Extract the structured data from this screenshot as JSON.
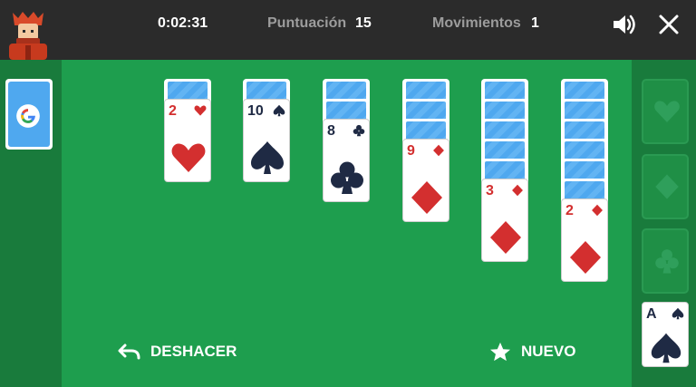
{
  "header": {
    "timer": "0:02:31",
    "score_label": "Puntuación",
    "score_value": "15",
    "moves_label": "Movimientos",
    "moves_value": "1",
    "sound_icon": "speaker-icon",
    "close_icon": "close-icon",
    "avatar_icon": "player-avatar-icon"
  },
  "stock": {
    "icon": "google-logo-icon"
  },
  "tableau": [
    {
      "hidden": 1,
      "top": {
        "rank": "2",
        "suit": "heart",
        "color": "#d32f2f"
      }
    },
    {
      "hidden": 1,
      "top": {
        "rank": "10",
        "suit": "spade",
        "color": "#1f2a44"
      }
    },
    {
      "hidden": 2,
      "top": {
        "rank": "8",
        "suit": "club",
        "color": "#1f2a44"
      }
    },
    {
      "hidden": 3,
      "top": {
        "rank": "9",
        "suit": "diamond",
        "color": "#d32f2f"
      }
    },
    {
      "hidden": 5,
      "top": {
        "rank": "3",
        "suit": "diamond",
        "color": "#d32f2f"
      }
    },
    {
      "hidden": 6,
      "top": {
        "rank": "2",
        "suit": "diamond",
        "color": "#d32f2f"
      }
    }
  ],
  "foundations": [
    {
      "suit": "heart",
      "icon": "heart-icon"
    },
    {
      "suit": "diamond",
      "icon": "diamond-icon"
    },
    {
      "suit": "club",
      "icon": "club-icon"
    }
  ],
  "foundation_card": {
    "rank": "A",
    "suit": "spade",
    "color": "#1f2a44"
  },
  "actions": {
    "undo_label": "DESHACER",
    "undo_icon": "undo-arrow-icon",
    "new_label": "NUEVO",
    "new_icon": "star-icon"
  },
  "colors": {
    "table": "#1e9e4e",
    "strip": "#197b3c",
    "topbar": "#2b2b2b",
    "card_back": "#4fa8ef",
    "red": "#d32f2f",
    "black": "#1f2a44"
  }
}
